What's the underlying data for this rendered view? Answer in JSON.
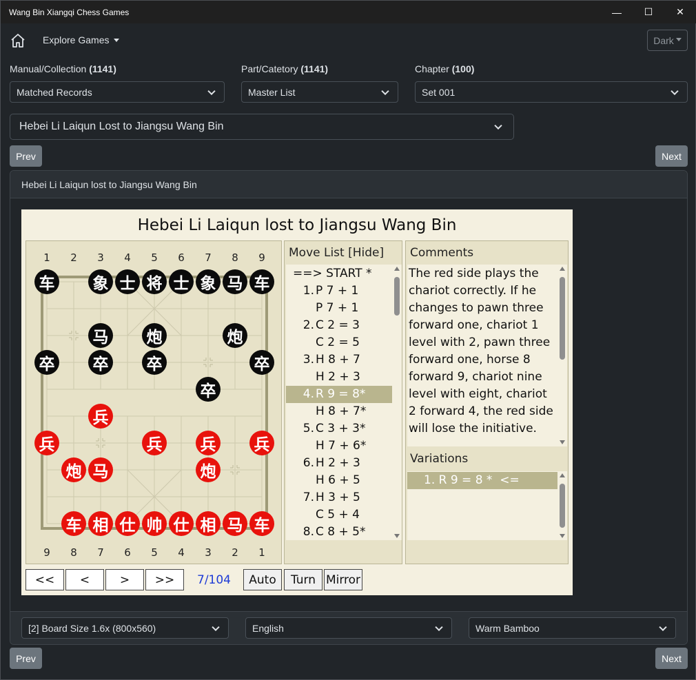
{
  "window": {
    "title": "Wang Bin Xiangqi Chess Games",
    "minimize": "—",
    "maximize": "☐",
    "close": "✕"
  },
  "navbar": {
    "explore_label": "Explore Games",
    "theme_label": "Dark"
  },
  "filters": {
    "manual": {
      "label": "Manual/Collection",
      "count": "(1141)",
      "value": "Matched Records"
    },
    "part": {
      "label": "Part/Catetory",
      "count": "(1141)",
      "value": "Master List"
    },
    "chapter": {
      "label": "Chapter",
      "count": "(100)",
      "value": "Set 001"
    },
    "game": {
      "value": "Hebei Li Laiqun Lost to Jiangsu Wang Bin"
    }
  },
  "nav": {
    "prev": "Prev",
    "next": "Next"
  },
  "card": {
    "header": "Hebei Li Laiqun lost to Jiangsu Wang Bin"
  },
  "viewer": {
    "title": "Hebei Li Laiqun lost to Jiangsu Wang Bin",
    "top_files": [
      "1",
      "2",
      "3",
      "4",
      "5",
      "6",
      "7",
      "8",
      "9"
    ],
    "bottom_files": [
      "9",
      "8",
      "7",
      "6",
      "5",
      "4",
      "3",
      "2",
      "1"
    ],
    "black_pieces": [
      {
        "c": "车",
        "f": 0,
        "r": 0
      },
      {
        "c": "象",
        "f": 2,
        "r": 0
      },
      {
        "c": "士",
        "f": 3,
        "r": 0
      },
      {
        "c": "将",
        "f": 4,
        "r": 0
      },
      {
        "c": "士",
        "f": 5,
        "r": 0
      },
      {
        "c": "象",
        "f": 6,
        "r": 0
      },
      {
        "c": "马",
        "f": 7,
        "r": 0
      },
      {
        "c": "车",
        "f": 8,
        "r": 0
      },
      {
        "c": "马",
        "f": 2,
        "r": 2
      },
      {
        "c": "炮",
        "f": 4,
        "r": 2
      },
      {
        "c": "炮",
        "f": 7,
        "r": 2
      },
      {
        "c": "卒",
        "f": 0,
        "r": 3
      },
      {
        "c": "卒",
        "f": 2,
        "r": 3
      },
      {
        "c": "卒",
        "f": 4,
        "r": 3
      },
      {
        "c": "卒",
        "f": 8,
        "r": 3
      },
      {
        "c": "卒",
        "f": 6,
        "r": 4
      }
    ],
    "red_pieces": [
      {
        "c": "兵",
        "f": 2,
        "r": 5
      },
      {
        "c": "兵",
        "f": 0,
        "r": 6
      },
      {
        "c": "兵",
        "f": 4,
        "r": 6
      },
      {
        "c": "兵",
        "f": 6,
        "r": 6
      },
      {
        "c": "兵",
        "f": 8,
        "r": 6
      },
      {
        "c": "炮",
        "f": 1,
        "r": 7
      },
      {
        "c": "马",
        "f": 2,
        "r": 7
      },
      {
        "c": "炮",
        "f": 6,
        "r": 7
      },
      {
        "c": "车",
        "f": 1,
        "r": 9
      },
      {
        "c": "相",
        "f": 2,
        "r": 9
      },
      {
        "c": "仕",
        "f": 3,
        "r": 9
      },
      {
        "c": "帅",
        "f": 4,
        "r": 9
      },
      {
        "c": "仕",
        "f": 5,
        "r": 9
      },
      {
        "c": "相",
        "f": 6,
        "r": 9
      },
      {
        "c": "马",
        "f": 7,
        "r": 9
      },
      {
        "c": "车",
        "f": 8,
        "r": 9
      }
    ],
    "move_list": {
      "header": "Move List [Hide]",
      "start": "==> START *",
      "rows": [
        {
          "num": "1.",
          "move": "P 7 + 1"
        },
        {
          "num": "",
          "move": "P 7 + 1"
        },
        {
          "num": "2.",
          "move": "C 2 = 3"
        },
        {
          "num": "",
          "move": "C 2 = 5"
        },
        {
          "num": "3.",
          "move": "H 8 + 7"
        },
        {
          "num": "",
          "move": "H 2 + 3"
        },
        {
          "num": "4.",
          "move": "R 9 = 8*",
          "selected": true
        },
        {
          "num": "",
          "move": "H 8 + 7*"
        },
        {
          "num": "5.",
          "move": "C 3 + 3*"
        },
        {
          "num": "",
          "move": "H 7 + 6*"
        },
        {
          "num": "6.",
          "move": "H 2 + 3"
        },
        {
          "num": "",
          "move": "H 6 + 5"
        },
        {
          "num": "7.",
          "move": "H 3 + 5"
        },
        {
          "num": "",
          "move": "C 5 + 4"
        },
        {
          "num": "8.",
          "move": "C 8 + 5*"
        }
      ]
    },
    "comments": {
      "header": "Comments",
      "text": "The red side plays the chariot correctly. If he changes to pawn three forward one, chariot 1 level with 2, pawn three forward one, horse 8 forward 9, chariot nine level with eight, chariot 2 forward 4, the red side will lose the initiative."
    },
    "variations": {
      "header": "Variations",
      "row": "1. R 9 = 8 *  <="
    },
    "controls": {
      "first": "<<",
      "prev": "<",
      "next": ">",
      "last": ">>",
      "counter": "7/104",
      "auto": "Auto",
      "turn": "Turn",
      "mirror": "Mirror"
    }
  },
  "footer": {
    "board_size": "[2] Board Size 1.6x (800x560)",
    "language": "English",
    "theme": "Warm Bamboo"
  },
  "colors": {
    "red_piece": "#e8120c",
    "black_piece": "#0b0b0b",
    "board": "#e7e2c8",
    "selected_row": "#b9b58e",
    "counter": "#1e3bd6"
  }
}
